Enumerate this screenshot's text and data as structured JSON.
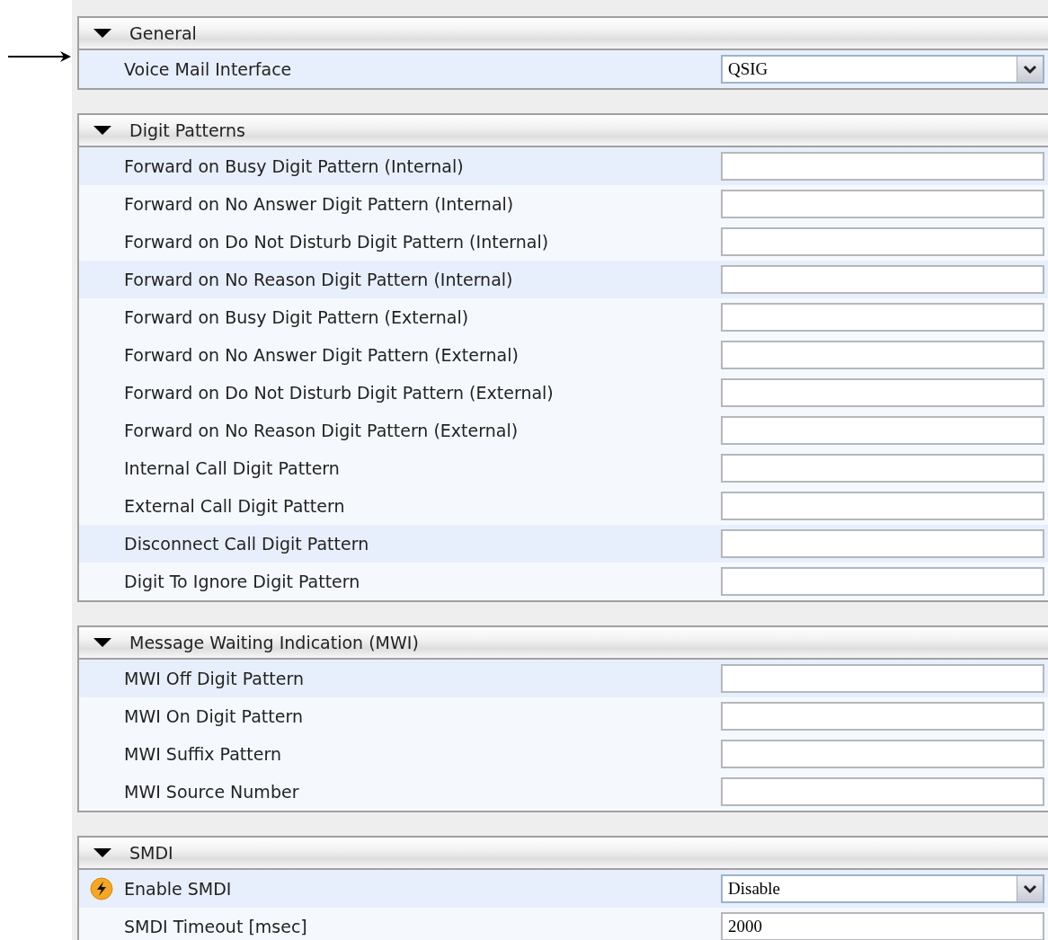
{
  "sections": [
    {
      "title": "General",
      "expanded": true,
      "rows": [
        {
          "label": "Voice Mail Interface",
          "shaded": true,
          "field": {
            "kind": "select",
            "value": "QSIG"
          }
        }
      ]
    },
    {
      "title": "Digit Patterns",
      "expanded": true,
      "rows": [
        {
          "label": "Forward on Busy Digit Pattern (Internal)",
          "shaded": true,
          "field": {
            "kind": "text"
          }
        },
        {
          "label": "Forward on No Answer Digit Pattern (Internal)",
          "shaded": false,
          "field": {
            "kind": "text"
          }
        },
        {
          "label": "Forward on Do Not Disturb Digit Pattern (Internal)",
          "shaded": false,
          "field": {
            "kind": "text"
          }
        },
        {
          "label": "Forward on No Reason Digit Pattern (Internal)",
          "shaded": true,
          "field": {
            "kind": "text"
          }
        },
        {
          "label": "Forward on Busy Digit Pattern (External)",
          "shaded": false,
          "field": {
            "kind": "text"
          }
        },
        {
          "label": "Forward on No Answer Digit Pattern (External)",
          "shaded": false,
          "field": {
            "kind": "text"
          }
        },
        {
          "label": "Forward on Do Not Disturb Digit Pattern (External)",
          "shaded": false,
          "field": {
            "kind": "text"
          }
        },
        {
          "label": "Forward on No Reason Digit Pattern (External)",
          "shaded": false,
          "field": {
            "kind": "text"
          }
        },
        {
          "label": "Internal Call Digit Pattern",
          "shaded": false,
          "field": {
            "kind": "text"
          }
        },
        {
          "label": "External Call Digit Pattern",
          "shaded": false,
          "field": {
            "kind": "text"
          }
        },
        {
          "label": "Disconnect Call Digit Pattern",
          "shaded": true,
          "field": {
            "kind": "text"
          }
        },
        {
          "label": "Digit To Ignore Digit Pattern",
          "shaded": false,
          "field": {
            "kind": "text"
          }
        }
      ]
    },
    {
      "title": "Message Waiting Indication (MWI)",
      "expanded": true,
      "rows": [
        {
          "label": "MWI Off Digit Pattern",
          "shaded": true,
          "field": {
            "kind": "text"
          }
        },
        {
          "label": "MWI On Digit Pattern",
          "shaded": false,
          "field": {
            "kind": "text"
          }
        },
        {
          "label": "MWI Suffix Pattern",
          "shaded": false,
          "field": {
            "kind": "text"
          }
        },
        {
          "label": "MWI Source Number",
          "shaded": false,
          "field": {
            "kind": "text"
          }
        }
      ]
    },
    {
      "title": "SMDI",
      "expanded": true,
      "rows": [
        {
          "label": "Enable SMDI",
          "shaded": true,
          "flagged": true,
          "field": {
            "kind": "select",
            "value": "Disable"
          }
        },
        {
          "label": "SMDI Timeout [msec]",
          "shaded": false,
          "field": {
            "kind": "text",
            "value": "2000"
          }
        }
      ]
    }
  ]
}
